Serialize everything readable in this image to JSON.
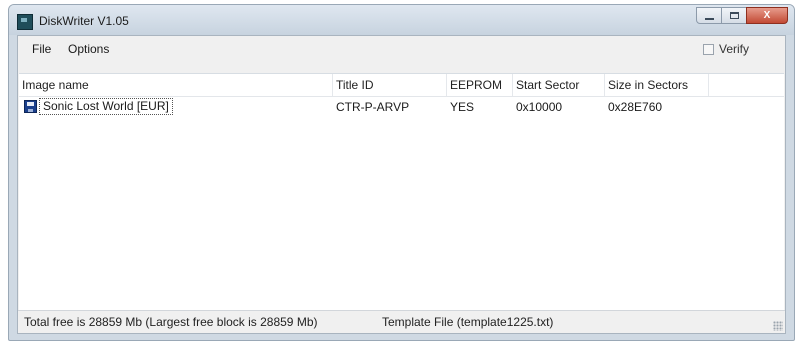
{
  "window": {
    "title": "DiskWriter V1.05",
    "app_icon": "disk-writer-icon"
  },
  "caption_buttons": {
    "minimize": "minimize-icon",
    "maximize": "maximize-icon",
    "close_glyph": "X"
  },
  "menu": {
    "file": "File",
    "options": "Options"
  },
  "verify": {
    "label": "Verify",
    "checked": false
  },
  "table": {
    "columns": [
      "Image name",
      "Title ID",
      "EEPROM",
      "Start Sector",
      "Size in Sectors"
    ],
    "rows": [
      {
        "icon": "floppy-disk-icon",
        "image_name": "Sonic Lost World [EUR]",
        "title_id": "CTR-P-ARVP",
        "eeprom": "YES",
        "start_sector": "0x10000",
        "size_in_sectors": "0x28E760"
      }
    ]
  },
  "status": {
    "free": "Total free is 28859 Mb  (Largest free block is 28859 Mb)",
    "template": "Template File (template1225.txt)"
  },
  "colors": {
    "title_bar": "#cfd9e3",
    "close_button": "#c24a34",
    "list_background": "#ffffff"
  }
}
